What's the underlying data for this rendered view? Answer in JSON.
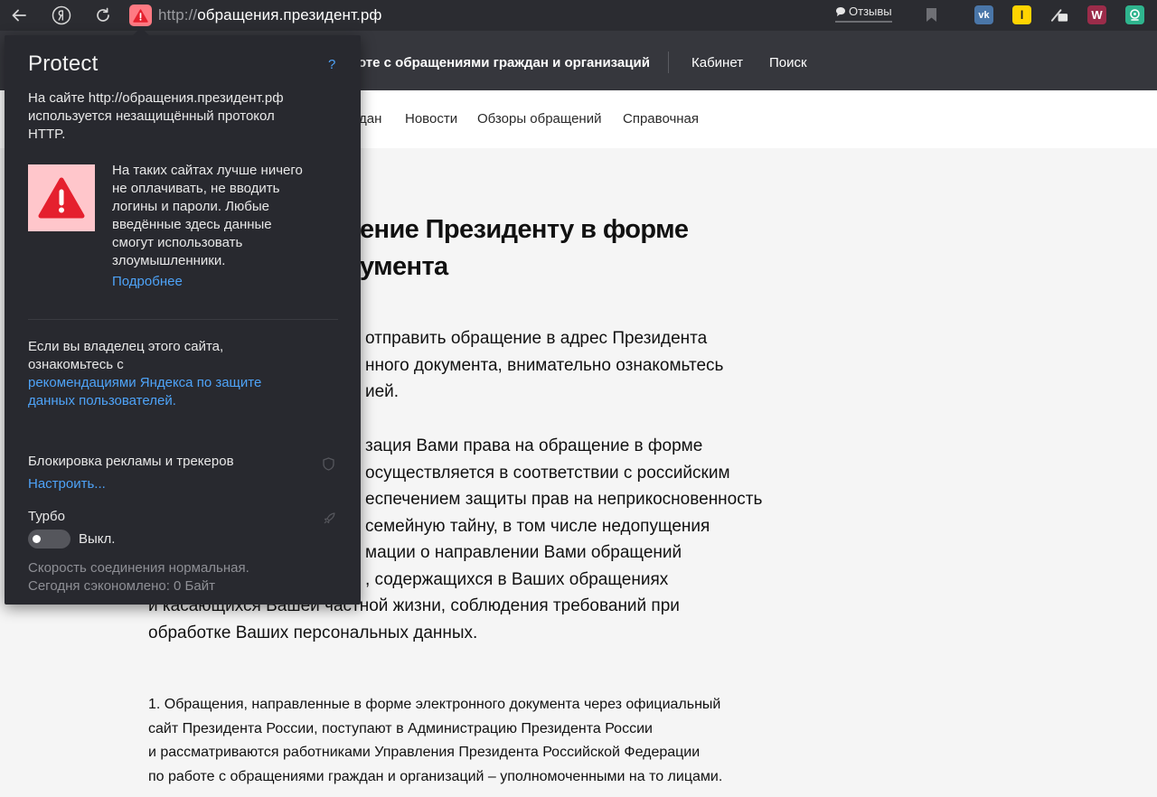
{
  "browser": {
    "url_protocol": "http://",
    "url_host": "обращения.президент.рф",
    "feedback_label": "Отзывы",
    "ext_vk": "vk",
    "ext_l": "l",
    "ext_w": "W"
  },
  "site": {
    "header_title": "оте с обращениями граждан и организаций",
    "header_links": [
      "Кабинет",
      "Поиск"
    ],
    "nav": [
      "дан",
      "Новости",
      "Обзоры обращений",
      "Справочная"
    ],
    "heading": [
      "ение Президенту в форме",
      "умента"
    ],
    "lead_lines": [
      "отправить обращение в адрес Президента",
      "нного документа, внимательно ознакомьтесь",
      "ией.",
      "",
      "зация Вами права на обращение в форме",
      "осуществляется в соответствии с российским",
      "еспечением защиты прав на неприкосновенность",
      "семейную тайну, в том числе недопущения",
      "мации о направлении Вами обращений",
      ", содержащихся в Ваших обращениях",
      "и касающихся Вашей частной жизни, соблюдения требований при",
      "обработке Ваших персональных данных."
    ],
    "paragraph_lines": [
      "1. Обращения, направленные в форме электронного документа через официальный",
      "сайт Президента России, поступают в Администрацию Президента России",
      "и рассматриваются работниками Управления Президента Российской Федерации",
      "по работе с обращениями граждан и организаций – уполномоченными на то лицами."
    ]
  },
  "protect": {
    "brand": "Protect",
    "help": "?",
    "intro_lines": [
      "На сайте http://обращения.президент.рф",
      "используется незащищённый протокол",
      "HTTP."
    ],
    "warning_lines": [
      "На таких сайтах лучше ничего",
      "не оплачивать, не вводить",
      "логины и пароли. Любые",
      "введённые здесь данные",
      "смогут использовать",
      "злоумышленники."
    ],
    "more_link": "Подробнее",
    "owner_lines": [
      "Если вы владелец этого сайта,",
      "ознакомьтесь с"
    ],
    "owner_link_lines": [
      "рекомендациями Яндекса по защите",
      "данных пользователей."
    ],
    "adblock_label": "Блокировка рекламы и трекеров",
    "adblock_link": "Настроить...",
    "turbo_label": "Турбо",
    "turbo_state": "Выкл.",
    "speed_text": "Скорость соединения нормальная.",
    "saved_text": "Сегодня сэкономлено: 0 Байт"
  },
  "colors": {
    "toolbar_bg": "#2b2c31",
    "popup_bg": "#28292f",
    "link": "#4ea3f8",
    "warning_red": "#e5202e",
    "warning_bg": "#ffc6cb"
  }
}
